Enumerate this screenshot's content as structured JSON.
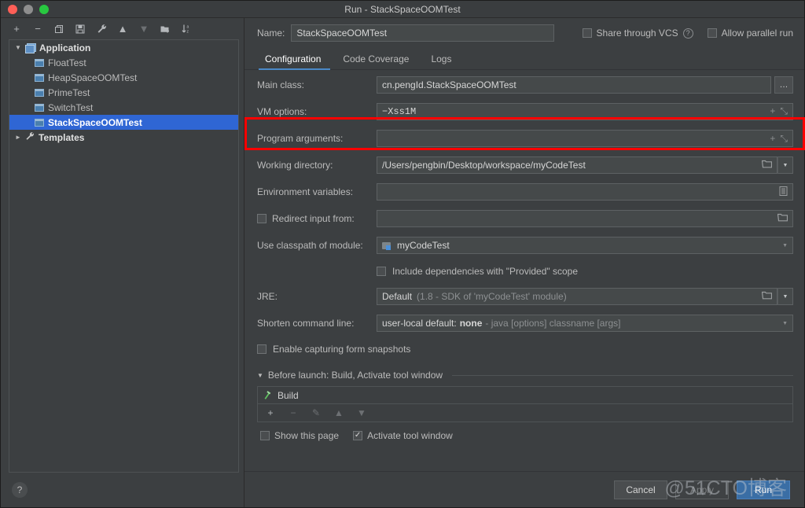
{
  "window": {
    "title": "Run - StackSpaceOOMTest",
    "traffic_lights": [
      "close",
      "minimize",
      "maximize"
    ]
  },
  "sidebar": {
    "toolbar": [
      {
        "name": "add-icon",
        "glyph": "+"
      },
      {
        "name": "remove-icon",
        "glyph": "−"
      },
      {
        "name": "copy-icon",
        "glyph": "⧉"
      },
      {
        "name": "save-icon",
        "glyph": "Ὃe"
      },
      {
        "name": "wrench-icon",
        "glyph": "🔧"
      },
      {
        "name": "move-up-icon",
        "glyph": "▲"
      },
      {
        "name": "move-down-icon",
        "glyph": "▼"
      },
      {
        "name": "new-folder-icon",
        "glyph": "📁"
      },
      {
        "name": "sort-alphabetically-icon",
        "glyph": "↓"
      }
    ],
    "tree": [
      {
        "label": "Application",
        "level": 0,
        "icon": "application-icon",
        "expanded": true,
        "selected": false
      },
      {
        "label": "FloatTest",
        "level": 1,
        "icon": "run-config-icon",
        "expanded": null,
        "selected": false
      },
      {
        "label": "HeapSpaceOOMTest",
        "level": 1,
        "icon": "run-config-icon",
        "expanded": null,
        "selected": false
      },
      {
        "label": "PrimeTest",
        "level": 1,
        "icon": "run-config-icon",
        "expanded": null,
        "selected": false
      },
      {
        "label": "SwitchTest",
        "level": 1,
        "icon": "run-config-icon",
        "expanded": null,
        "selected": false
      },
      {
        "label": "StackSpaceOOMTest",
        "level": 1,
        "icon": "run-config-icon",
        "expanded": null,
        "selected": true
      },
      {
        "label": "Templates",
        "level": 0,
        "icon": "templates-wrench-icon",
        "expanded": false,
        "selected": false
      }
    ],
    "help_glyph": "?"
  },
  "header": {
    "name_label": "Name:",
    "name_value": "StackSpaceOOMTest",
    "name_placeholder": "",
    "share_vcs_label": "Share through VCS",
    "share_vcs_checked": false,
    "share_vcs_help_glyph": "?",
    "allow_parallel_label": "Allow parallel run",
    "allow_parallel_checked": false
  },
  "tabs": [
    {
      "label": "Configuration",
      "active": true
    },
    {
      "label": "Code Coverage",
      "active": false
    },
    {
      "label": "Logs",
      "active": false
    }
  ],
  "form": {
    "main_class": {
      "label": "Main class:",
      "value": "cn.pengId.StackSpaceOOMTest",
      "browse_glyph": "…"
    },
    "vm_options": {
      "label": "VM options:",
      "value": "−Xss1M",
      "expand_glyph": "⤡",
      "add_glyph": "+",
      "highlight_color": "#ff0000"
    },
    "program_arguments": {
      "label": "Program arguments:",
      "value": "",
      "expand_glyph": "⤡",
      "add_glyph": "+"
    },
    "working_directory": {
      "label": "Working directory:",
      "value": "/Users/pengbin/Desktop/workspace/myCodeTest",
      "folder_glyph": "🗀",
      "dropdown_glyph": "▼"
    },
    "environment_variables": {
      "label": "Environment variables:",
      "value": "",
      "browse_glyph": "≣"
    },
    "redirect_input": {
      "label": "Redirect input from:",
      "checked": false,
      "value": "",
      "folder_glyph": "🗀"
    },
    "use_classpath_of_module": {
      "label": "Use classpath of module:",
      "value": "myCodeTest",
      "dropdown_glyph": "▼"
    },
    "include_provided": {
      "label": "Include dependencies with \"Provided\" scope",
      "checked": false
    },
    "jre": {
      "label": "JRE:",
      "value": "Default",
      "value_suffix": "(1.8 - SDK of 'myCodeTest' module)",
      "folder_glyph": "🗀",
      "dropdown_glyph": "▼"
    },
    "shorten_command_line": {
      "label": "Shorten command line:",
      "value_prefix": "user-local default:",
      "value_strong": "none",
      "value_suffix": "- java [options] classname [args]",
      "dropdown_glyph": "▼"
    },
    "enable_form_snapshots": {
      "label": "Enable capturing form snapshots",
      "checked": false
    }
  },
  "before_launch": {
    "title": "Before launch: Build, Activate tool window",
    "twisty_glyph": "▼",
    "items": [
      {
        "label": "Build",
        "icon": "hammer-icon",
        "glyph": "⚒"
      }
    ],
    "actions": [
      {
        "name": "add-task-icon",
        "glyph": "+",
        "enabled": true
      },
      {
        "name": "remove-task-icon",
        "glyph": "−",
        "enabled": false
      },
      {
        "name": "edit-task-icon",
        "glyph": "✎",
        "enabled": false
      },
      {
        "name": "move-task-up-icon",
        "glyph": "▲",
        "enabled": false
      },
      {
        "name": "move-task-down-icon",
        "glyph": "▼",
        "enabled": false
      }
    ],
    "show_this_page": {
      "label": "Show this page",
      "checked": false
    },
    "activate_tool_window": {
      "label": "Activate tool window",
      "checked": true
    }
  },
  "footer": {
    "cancel_label": "Cancel",
    "apply_label": "Apply",
    "apply_enabled": false,
    "run_label": "Run",
    "run_accent": "#3a6ea5"
  },
  "watermark": {
    "text": "@51CTO博客"
  }
}
